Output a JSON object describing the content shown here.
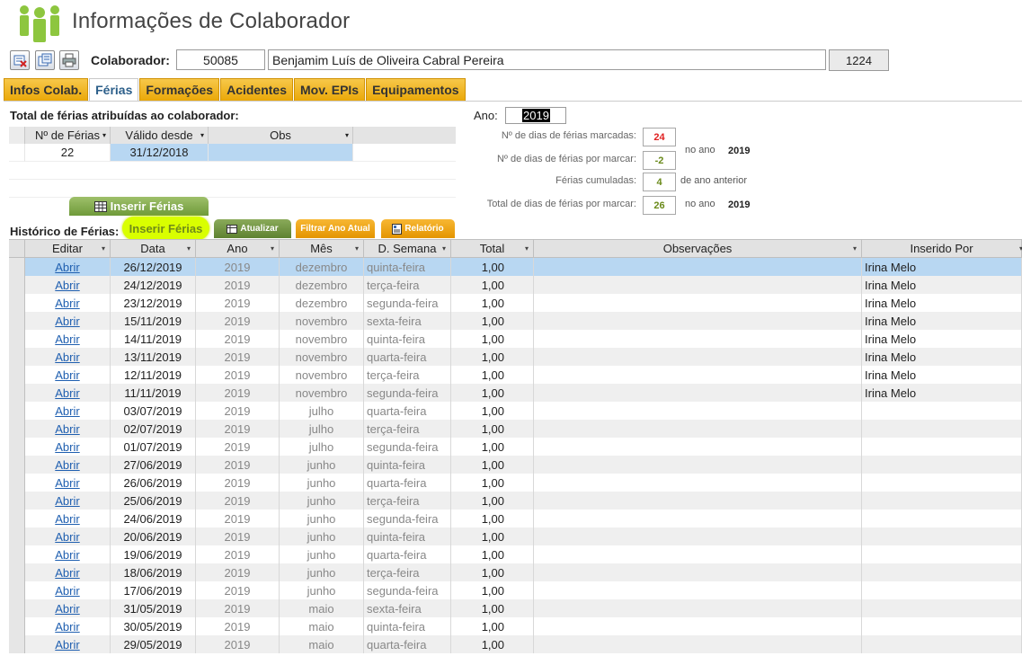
{
  "header": {
    "title": "Informações de Colaborador"
  },
  "toolbar": {
    "colaborador_label": "Colaborador:",
    "colaborador_id": "50085",
    "colaborador_name": "Benjamim Luís de Oliveira Cabral Pereira",
    "extra_value": "1224"
  },
  "tabs": [
    {
      "label": "Infos Colab."
    },
    {
      "label": "Férias"
    },
    {
      "label": "Formações"
    },
    {
      "label": "Acidentes"
    },
    {
      "label": "Mov. EPIs"
    },
    {
      "label": "Equipamentos"
    }
  ],
  "summary": {
    "title": "Total de férias atribuídas ao colaborador:",
    "columns": [
      "Nº de Férias",
      "Válido desde",
      "Obs"
    ],
    "row": {
      "n_ferias": "22",
      "valido_desde": "31/12/2018",
      "obs": ""
    },
    "insert_button": "Inserir Férias"
  },
  "stats": {
    "ano_label": "Ano:",
    "ano_value": "2019",
    "marcadas_label": "Nº de dias de férias marcadas:",
    "marcadas_value": "24",
    "por_marcar_label": "Nº de dias de férias por marcar:",
    "por_marcar_value": "-2",
    "no_ano_label": "no ano",
    "no_ano_value": "2019",
    "cumuladas_label": "Férias cumuladas:",
    "cumuladas_value": "4",
    "ano_anterior_label": "de ano anterior",
    "total_label": "Total de dias de férias por marcar:",
    "total_value": "26",
    "no_ano_label2": "no ano",
    "no_ano_value2": "2019",
    "colors": {
      "marcadas": "#e02020",
      "por_marcar": "#6a8a1a",
      "cumuladas": "#6a8a1a",
      "total": "#6a8a1a"
    }
  },
  "history": {
    "label": "Histórico de Férias:",
    "btn_inserir": "Inserir Férias",
    "btn_atualizar": "Atualizar",
    "btn_filtrar": "Filtrar Ano Atual",
    "btn_relatorio": "Relatório",
    "columns": [
      "Editar",
      "Data",
      "Ano",
      "Mês",
      "D. Semana",
      "Total",
      "Observações",
      "Inserido Por"
    ],
    "rows": [
      {
        "edit": "Abrir",
        "data": "26/12/2019",
        "ano": "2019",
        "mes": "dezembro",
        "dia": "quinta-feira",
        "total": "1,00",
        "obs": "",
        "por": "Irina Melo"
      },
      {
        "edit": "Abrir",
        "data": "24/12/2019",
        "ano": "2019",
        "mes": "dezembro",
        "dia": "terça-feira",
        "total": "1,00",
        "obs": "",
        "por": "Irina Melo"
      },
      {
        "edit": "Abrir",
        "data": "23/12/2019",
        "ano": "2019",
        "mes": "dezembro",
        "dia": "segunda-feira",
        "total": "1,00",
        "obs": "",
        "por": "Irina Melo"
      },
      {
        "edit": "Abrir",
        "data": "15/11/2019",
        "ano": "2019",
        "mes": "novembro",
        "dia": "sexta-feira",
        "total": "1,00",
        "obs": "",
        "por": "Irina Melo"
      },
      {
        "edit": "Abrir",
        "data": "14/11/2019",
        "ano": "2019",
        "mes": "novembro",
        "dia": "quinta-feira",
        "total": "1,00",
        "obs": "",
        "por": "Irina Melo"
      },
      {
        "edit": "Abrir",
        "data": "13/11/2019",
        "ano": "2019",
        "mes": "novembro",
        "dia": "quarta-feira",
        "total": "1,00",
        "obs": "",
        "por": "Irina Melo"
      },
      {
        "edit": "Abrir",
        "data": "12/11/2019",
        "ano": "2019",
        "mes": "novembro",
        "dia": "terça-feira",
        "total": "1,00",
        "obs": "",
        "por": "Irina Melo"
      },
      {
        "edit": "Abrir",
        "data": "11/11/2019",
        "ano": "2019",
        "mes": "novembro",
        "dia": "segunda-feira",
        "total": "1,00",
        "obs": "",
        "por": "Irina Melo"
      },
      {
        "edit": "Abrir",
        "data": "03/07/2019",
        "ano": "2019",
        "mes": "julho",
        "dia": "quarta-feira",
        "total": "1,00",
        "obs": "",
        "por": ""
      },
      {
        "edit": "Abrir",
        "data": "02/07/2019",
        "ano": "2019",
        "mes": "julho",
        "dia": "terça-feira",
        "total": "1,00",
        "obs": "",
        "por": ""
      },
      {
        "edit": "Abrir",
        "data": "01/07/2019",
        "ano": "2019",
        "mes": "julho",
        "dia": "segunda-feira",
        "total": "1,00",
        "obs": "",
        "por": ""
      },
      {
        "edit": "Abrir",
        "data": "27/06/2019",
        "ano": "2019",
        "mes": "junho",
        "dia": "quinta-feira",
        "total": "1,00",
        "obs": "",
        "por": ""
      },
      {
        "edit": "Abrir",
        "data": "26/06/2019",
        "ano": "2019",
        "mes": "junho",
        "dia": "quarta-feira",
        "total": "1,00",
        "obs": "",
        "por": ""
      },
      {
        "edit": "Abrir",
        "data": "25/06/2019",
        "ano": "2019",
        "mes": "junho",
        "dia": "terça-feira",
        "total": "1,00",
        "obs": "",
        "por": ""
      },
      {
        "edit": "Abrir",
        "data": "24/06/2019",
        "ano": "2019",
        "mes": "junho",
        "dia": "segunda-feira",
        "total": "1,00",
        "obs": "",
        "por": ""
      },
      {
        "edit": "Abrir",
        "data": "20/06/2019",
        "ano": "2019",
        "mes": "junho",
        "dia": "quinta-feira",
        "total": "1,00",
        "obs": "",
        "por": ""
      },
      {
        "edit": "Abrir",
        "data": "19/06/2019",
        "ano": "2019",
        "mes": "junho",
        "dia": "quarta-feira",
        "total": "1,00",
        "obs": "",
        "por": ""
      },
      {
        "edit": "Abrir",
        "data": "18/06/2019",
        "ano": "2019",
        "mes": "junho",
        "dia": "terça-feira",
        "total": "1,00",
        "obs": "",
        "por": ""
      },
      {
        "edit": "Abrir",
        "data": "17/06/2019",
        "ano": "2019",
        "mes": "junho",
        "dia": "segunda-feira",
        "total": "1,00",
        "obs": "",
        "por": ""
      },
      {
        "edit": "Abrir",
        "data": "31/05/2019",
        "ano": "2019",
        "mes": "maio",
        "dia": "sexta-feira",
        "total": "1,00",
        "obs": "",
        "por": ""
      },
      {
        "edit": "Abrir",
        "data": "30/05/2019",
        "ano": "2019",
        "mes": "maio",
        "dia": "quinta-feira",
        "total": "1,00",
        "obs": "",
        "por": ""
      },
      {
        "edit": "Abrir",
        "data": "29/05/2019",
        "ano": "2019",
        "mes": "maio",
        "dia": "quarta-feira",
        "total": "1,00",
        "obs": "",
        "por": ""
      }
    ]
  },
  "icons": {
    "app": "people-group-icon",
    "toolbar": [
      "edit-delete-icon",
      "save-record-icon",
      "print-icon"
    ],
    "datasheet": "datasheet-icon",
    "report": "report-icon"
  },
  "colors": {
    "accent_green": "#8dc63f",
    "tab_orange": "#f0b020",
    "selected_row": "#b8d7f2",
    "link": "#1f5fb0"
  }
}
